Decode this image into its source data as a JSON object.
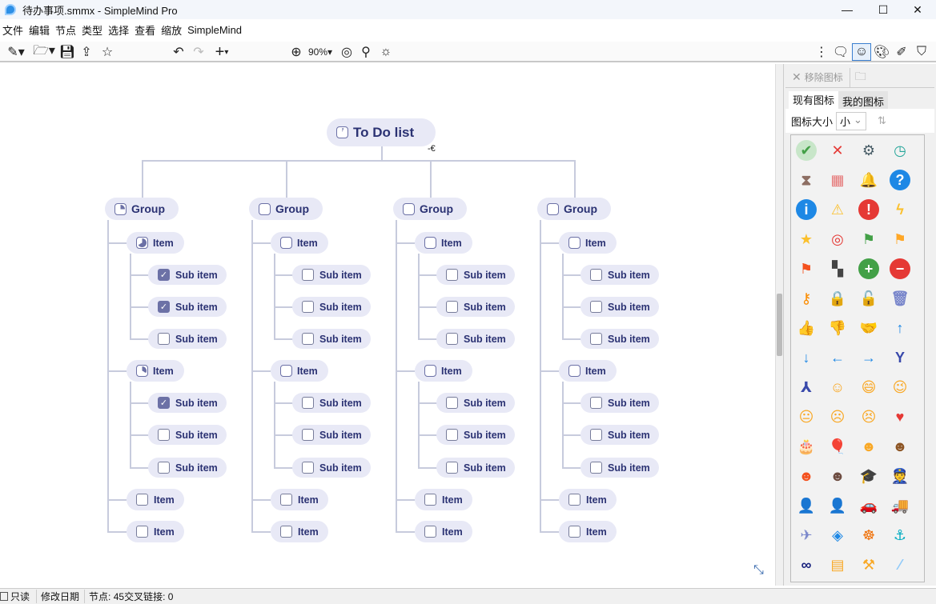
{
  "window": {
    "title": "待办事项.smmx - SimpleMind Pro",
    "minimize": "—",
    "maximize": "☐",
    "close": "✕"
  },
  "menu": [
    "文件",
    "编辑",
    "节点",
    "类型",
    "选择",
    "查看",
    "缩放",
    "SimpleMind"
  ],
  "toolbar": {
    "zoom": "90%"
  },
  "map": {
    "root": "To Do list",
    "groups": [
      {
        "label": "Group",
        "progress": 0.25,
        "items": [
          {
            "label": "Item",
            "progress": 0.67,
            "subs": [
              {
                "label": "Sub item",
                "checked": true
              },
              {
                "label": "Sub item",
                "checked": true
              },
              {
                "label": "Sub item",
                "checked": false
              }
            ]
          },
          {
            "label": "Item",
            "progress": 0.33,
            "subs": [
              {
                "label": "Sub item",
                "checked": true
              },
              {
                "label": "Sub item",
                "checked": false
              },
              {
                "label": "Sub item",
                "checked": false
              }
            ]
          },
          {
            "label": "Item",
            "checked": false
          },
          {
            "label": "Item",
            "checked": false
          }
        ]
      },
      {
        "label": "Group",
        "progress": 0,
        "items": [
          {
            "label": "Item",
            "progress": 0,
            "subs": [
              {
                "label": "Sub item",
                "checked": false
              },
              {
                "label": "Sub item",
                "checked": false
              },
              {
                "label": "Sub item",
                "checked": false
              }
            ]
          },
          {
            "label": "Item",
            "progress": 0,
            "subs": [
              {
                "label": "Sub item",
                "checked": false
              },
              {
                "label": "Sub item",
                "checked": false
              },
              {
                "label": "Sub item",
                "checked": false
              }
            ]
          },
          {
            "label": "Item",
            "checked": false
          },
          {
            "label": "Item",
            "checked": false
          }
        ]
      },
      {
        "label": "Group",
        "progress": 0,
        "items": [
          {
            "label": "Item",
            "progress": 0,
            "subs": [
              {
                "label": "Sub item",
                "checked": false
              },
              {
                "label": "Sub item",
                "checked": false
              },
              {
                "label": "Sub item",
                "checked": false
              }
            ]
          },
          {
            "label": "Item",
            "progress": 0,
            "subs": [
              {
                "label": "Sub item",
                "checked": false
              },
              {
                "label": "Sub item",
                "checked": false
              },
              {
                "label": "Sub item",
                "checked": false
              }
            ]
          },
          {
            "label": "Item",
            "checked": false
          },
          {
            "label": "Item",
            "checked": false
          }
        ]
      },
      {
        "label": "Group",
        "progress": 0,
        "items": [
          {
            "label": "Item",
            "progress": 0,
            "subs": [
              {
                "label": "Sub item",
                "checked": false
              },
              {
                "label": "Sub item",
                "checked": false
              },
              {
                "label": "Sub item",
                "checked": false
              }
            ]
          },
          {
            "label": "Item",
            "progress": 0,
            "subs": [
              {
                "label": "Sub item",
                "checked": false
              },
              {
                "label": "Sub item",
                "checked": false
              },
              {
                "label": "Sub item",
                "checked": false
              }
            ]
          },
          {
            "label": "Item",
            "checked": false
          },
          {
            "label": "Item",
            "checked": false
          }
        ]
      }
    ]
  },
  "panel": {
    "remove_icon": "移除图标",
    "tabs": [
      "现有图标",
      "我的图标"
    ],
    "active_tab": 0,
    "size_label": "图标大小",
    "size_value": "小",
    "icons": [
      {
        "name": "check",
        "g": "✔",
        "c": "#43a047",
        "bg": "#c8e6c9"
      },
      {
        "name": "cross",
        "g": "✕",
        "c": "#e53935"
      },
      {
        "name": "gear",
        "g": "⚙",
        "c": "#455a64"
      },
      {
        "name": "clock",
        "g": "◷",
        "c": "#26a69a"
      },
      {
        "name": "hourglass",
        "g": "⧗",
        "c": "#8d6e63"
      },
      {
        "name": "calendar",
        "g": "▦",
        "c": "#e57373"
      },
      {
        "name": "bell",
        "g": "🔔",
        "c": "#fbc02d"
      },
      {
        "name": "question",
        "g": "?",
        "c": "#fff",
        "bg": "#1e88e5"
      },
      {
        "name": "info",
        "g": "i",
        "c": "#fff",
        "bg": "#1e88e5"
      },
      {
        "name": "warning",
        "g": "⚠",
        "c": "#fbc02d"
      },
      {
        "name": "error",
        "g": "!",
        "c": "#fff",
        "bg": "#e53935"
      },
      {
        "name": "lightning",
        "g": "ϟ",
        "c": "#fbc02d"
      },
      {
        "name": "star",
        "g": "★",
        "c": "#fbc02d"
      },
      {
        "name": "target",
        "g": "◎",
        "c": "#e53935"
      },
      {
        "name": "flag-green",
        "g": "⚑",
        "c": "#43a047"
      },
      {
        "name": "flag-orange",
        "g": "⚑",
        "c": "#ffa726"
      },
      {
        "name": "flag-red",
        "g": "⚑",
        "c": "#f4511e"
      },
      {
        "name": "flag-checkered",
        "g": "▚",
        "c": "#444"
      },
      {
        "name": "plus",
        "g": "+",
        "c": "#fff",
        "bg": "#43a047"
      },
      {
        "name": "minus",
        "g": "−",
        "c": "#fff",
        "bg": "#e53935"
      },
      {
        "name": "key",
        "g": "⚷",
        "c": "#fb8c00"
      },
      {
        "name": "lock",
        "g": "🔒",
        "c": "#fb8c00"
      },
      {
        "name": "unlock",
        "g": "🔓",
        "c": "#fb8c00"
      },
      {
        "name": "trash",
        "g": "🗑",
        "c": "#7986cb"
      },
      {
        "name": "thumbs-up",
        "g": "👍",
        "c": "#f5c18a"
      },
      {
        "name": "thumbs-down",
        "g": "👎",
        "c": "#f5c18a"
      },
      {
        "name": "handshake",
        "g": "🤝",
        "c": "#e6a04f"
      },
      {
        "name": "arrow-up",
        "g": "↑",
        "c": "#1e88e5"
      },
      {
        "name": "arrow-down",
        "g": "↓",
        "c": "#1e88e5"
      },
      {
        "name": "arrow-left",
        "g": "←",
        "c": "#1e88e5"
      },
      {
        "name": "arrow-right",
        "g": "→",
        "c": "#1e88e5"
      },
      {
        "name": "fork",
        "g": "Y",
        "c": "#3949ab"
      },
      {
        "name": "merge",
        "g": "⅄",
        "c": "#3949ab"
      },
      {
        "name": "smile",
        "g": "☺",
        "c": "#f9a825"
      },
      {
        "name": "laugh",
        "g": "😄",
        "c": "#f9a825"
      },
      {
        "name": "wink",
        "g": "😉",
        "c": "#f9a825"
      },
      {
        "name": "neutral",
        "g": "😐",
        "c": "#f9a825"
      },
      {
        "name": "sad",
        "g": "☹",
        "c": "#f9a825"
      },
      {
        "name": "cry",
        "g": "😣",
        "c": "#f9a825"
      },
      {
        "name": "heart",
        "g": "♥",
        "c": "#e53935"
      },
      {
        "name": "cake",
        "g": "🎂",
        "c": "#ec407a"
      },
      {
        "name": "balloon",
        "g": "🎈",
        "c": "#e53935"
      },
      {
        "name": "boy",
        "g": "☻",
        "c": "#f9a825"
      },
      {
        "name": "boy-dark",
        "g": "☻",
        "c": "#8d5524"
      },
      {
        "name": "woman",
        "g": "☻",
        "c": "#f4511e"
      },
      {
        "name": "woman-dark",
        "g": "☻",
        "c": "#6d4c41"
      },
      {
        "name": "graduation",
        "g": "🎓",
        "c": "#455a64"
      },
      {
        "name": "police",
        "g": "👮",
        "c": "#283593"
      },
      {
        "name": "businessman",
        "g": "👤",
        "c": "#455a64"
      },
      {
        "name": "firefighter",
        "g": "👤",
        "c": "#2e7d32"
      },
      {
        "name": "car",
        "g": "🚗",
        "c": "#e53935"
      },
      {
        "name": "truck",
        "g": "🚚",
        "c": "#26a69a"
      },
      {
        "name": "airplane",
        "g": "✈",
        "c": "#7986cb"
      },
      {
        "name": "compass",
        "g": "◈",
        "c": "#1e88e5"
      },
      {
        "name": "helm",
        "g": "☸",
        "c": "#ef6c00"
      },
      {
        "name": "anchor",
        "g": "⚓",
        "c": "#00acc1"
      },
      {
        "name": "binoculars",
        "g": "∞",
        "c": "#1a237e"
      },
      {
        "name": "toolbox",
        "g": "▤",
        "c": "#f9a825"
      },
      {
        "name": "hammer",
        "g": "⚒",
        "c": "#f9a825"
      },
      {
        "name": "brush",
        "g": "⁄",
        "c": "#90caf9"
      }
    ]
  },
  "status": {
    "readonly": "只读",
    "modified": "修改日期",
    "nodes": "节点: 45",
    "crosslinks": "交叉链接: 0"
  }
}
